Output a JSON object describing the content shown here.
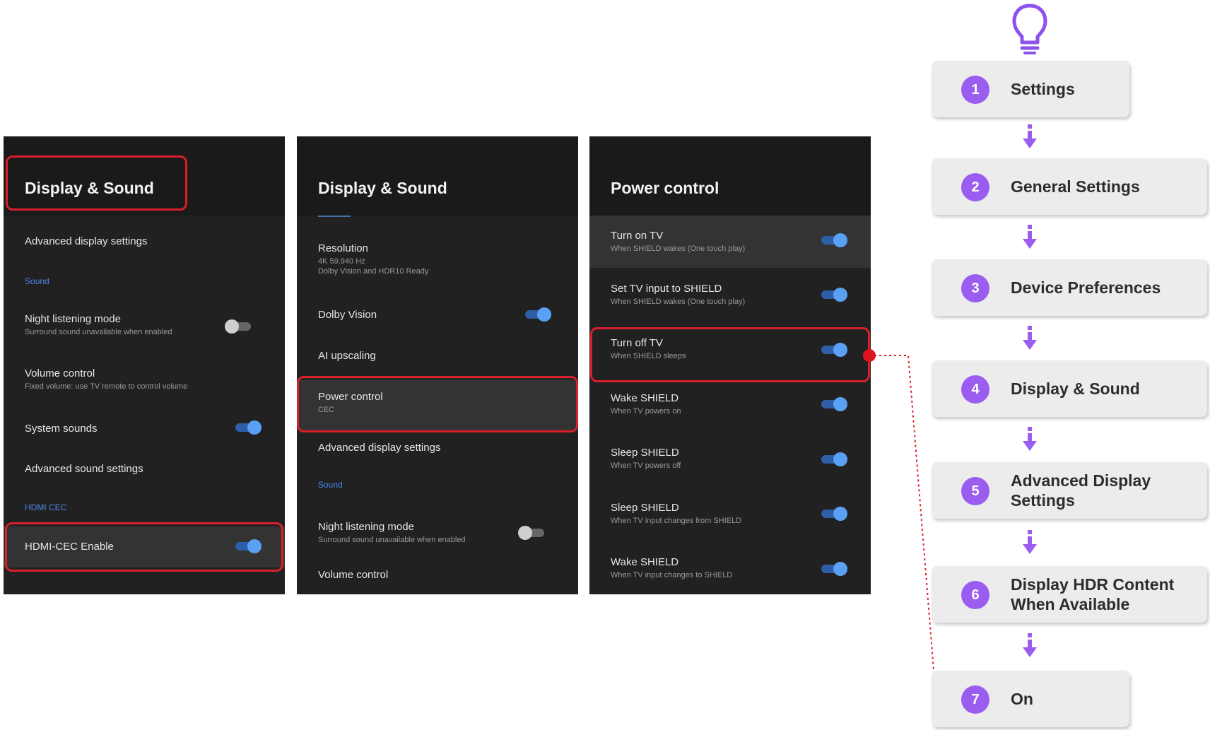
{
  "panel1": {
    "title": "Display & Sound",
    "rows": [
      {
        "main": "Advanced display settings"
      },
      {
        "section": "Sound"
      },
      {
        "main": "Night listening mode",
        "sub": "Surround sound unavailable when enabled"
      },
      {
        "main": "Volume control",
        "sub": "Fixed volume: use TV remote to control volume"
      },
      {
        "main": "System sounds"
      },
      {
        "main": "Advanced sound settings"
      },
      {
        "section": "HDMI CEC"
      },
      {
        "main": "HDMI-CEC Enable"
      }
    ]
  },
  "panel2": {
    "title": "Display & Sound",
    "rows": [
      {
        "main": "Resolution",
        "sub": "4K 59.940 Hz",
        "sub2": "Dolby Vision and HDR10 Ready"
      },
      {
        "main": "Dolby Vision"
      },
      {
        "main": "AI upscaling"
      },
      {
        "main": "Power control",
        "sub": "CEC"
      },
      {
        "main": "Advanced display settings"
      },
      {
        "section": "Sound"
      },
      {
        "main": "Night listening mode",
        "sub": "Surround sound unavailable when enabled"
      },
      {
        "main": "Volume control"
      }
    ]
  },
  "panel3": {
    "title": "Power control",
    "rows": [
      {
        "main": "Turn on TV",
        "sub": "When SHIELD wakes (One touch play)"
      },
      {
        "main": "Set TV input to SHIELD",
        "sub": "When SHIELD wakes (One touch play)"
      },
      {
        "main": "Turn off TV",
        "sub": "When SHIELD sleeps"
      },
      {
        "main": "Wake SHIELD",
        "sub": "When TV powers on"
      },
      {
        "main": "Sleep SHIELD",
        "sub": "When TV powers off"
      },
      {
        "main": "Sleep SHIELD",
        "sub": "When TV input changes from SHIELD"
      },
      {
        "main": "Wake SHIELD",
        "sub": "When TV input changes to SHIELD"
      }
    ]
  },
  "toggles": {
    "night_listening_1": false,
    "system_sounds": true,
    "hdmi_cec_enable": true,
    "dolby_vision": true,
    "night_listening_2": false,
    "turn_on_tv": true,
    "set_tv_input": true,
    "turn_off_tv": true,
    "wake_shield_1": true,
    "sleep_shield_1": true,
    "sleep_shield_2": true,
    "wake_shield_2": true
  },
  "steps": [
    {
      "num": "1",
      "label": "Settings"
    },
    {
      "num": "2",
      "label": "General Settings"
    },
    {
      "num": "3",
      "label": "Device Preferences"
    },
    {
      "num": "4",
      "label": "Display & Sound"
    },
    {
      "num": "5",
      "label": "Advanced Display\nSettings"
    },
    {
      "num": "6",
      "label": "Display HDR Content\nWhen Available"
    },
    {
      "num": "7",
      "label": "On"
    }
  ],
  "colors": {
    "highlight": "#d81f2a",
    "accent": "#9b5cf0",
    "toggle_on": "#5aa1f5"
  },
  "icons": {
    "tip": "lightbulb-icon",
    "flow": "arrow-down-icon"
  }
}
